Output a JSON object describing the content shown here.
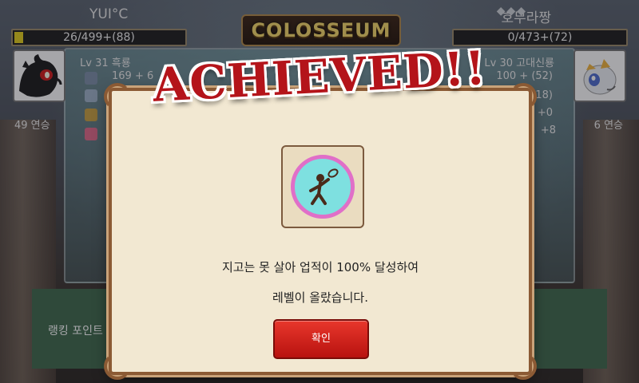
{
  "header": {
    "title": "COLOSSEUM",
    "decor": "◆◆◆"
  },
  "player_left": {
    "name": "YUI°C",
    "points_text": "26/499+(88)",
    "points_fill": 0.05,
    "level_text": "Lv 31 흑룡",
    "stat1": "169 + 6",
    "streak": "49 연승"
  },
  "player_right": {
    "name": "호무라짱",
    "points_text": "0/473+(72)",
    "points_fill": 0,
    "level_text": "Lv 30 고대신룡",
    "stat1": "100 + (52)",
    "stat2": "(18)",
    "stat3": "+0",
    "stat4": "+8",
    "streak": "6 연승"
  },
  "ranking_label": "랭킹 포인트",
  "dialog": {
    "banner": "ACHIEVED!!",
    "badge_icon": "tennis-player-icon",
    "message_line1": "지고는 못 살아 업적이 100% 달성하여",
    "message_line2": "레벨이 올랐습니다.",
    "confirm_label": "확인"
  },
  "colors": {
    "accent_red": "#b4141a",
    "gold": "#f6d96a",
    "dialog_bg": "#f2e8d2",
    "frame_brown": "#8b5a34",
    "progress_fill": "#e4cf1c"
  }
}
